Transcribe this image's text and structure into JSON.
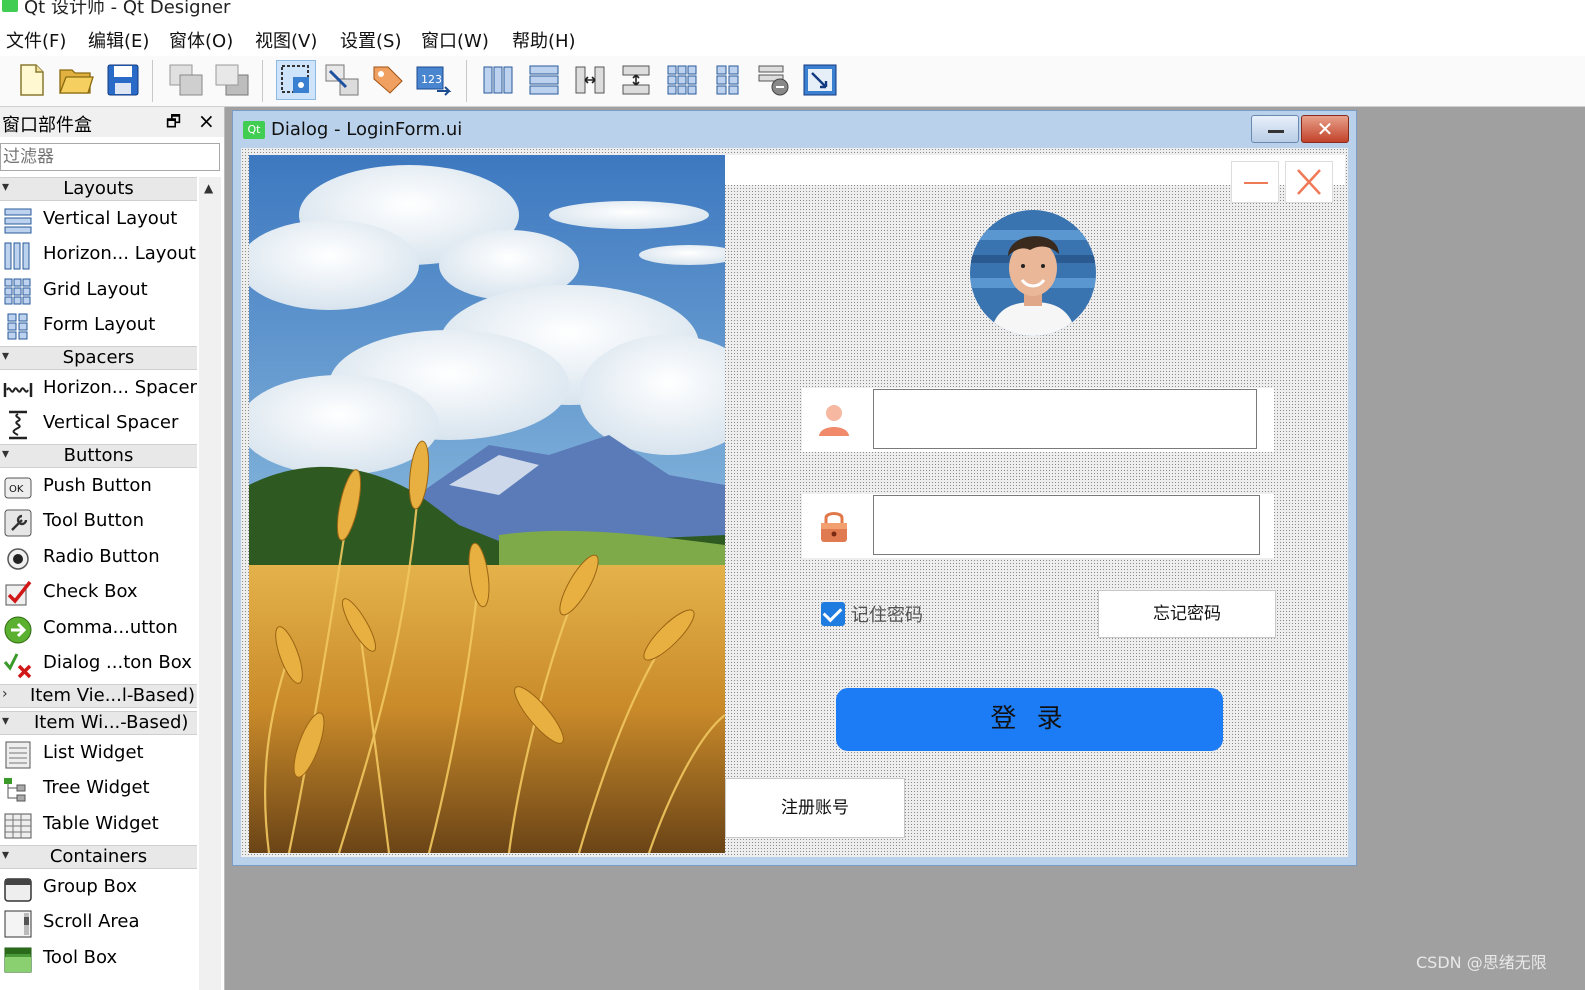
{
  "app": {
    "title": "Qt 设计师 - Qt Designer"
  },
  "menu": [
    "文件(F)",
    "编辑(E)",
    "窗体(O)",
    "视图(V)",
    "设置(S)",
    "窗口(W)",
    "帮助(H)"
  ],
  "toolbar": {
    "icons": [
      "new-file-icon",
      "open-folder-icon",
      "save-icon",
      "send-to-back-icon",
      "bring-to-front-icon",
      "edit-widgets-icon",
      "edit-signals-slots-icon",
      "edit-buddies-icon",
      "edit-tab-order-icon",
      "layout-horizontal-icon",
      "layout-vertical-icon",
      "layout-horizontal-splitter-icon",
      "layout-vertical-splitter-icon",
      "layout-grid-icon",
      "layout-form-icon",
      "break-layout-icon",
      "adjust-size-icon"
    ],
    "active": "edit-widgets-icon"
  },
  "widget_box": {
    "title": "窗口部件盒",
    "filter_placeholder": "过滤器",
    "layouts": "Layouts",
    "spacers": "Spacers",
    "buttons": "Buttons",
    "item_views": "Item Vie...l-Based)",
    "item_widgets": "Item Wi...-Based)",
    "containers": "Containers",
    "vertical_layout": "Vertical Layout",
    "horizontal_layout": "Horizon... Layout",
    "grid_layout": "Grid Layout",
    "form_layout": "Form Layout",
    "horizontal_spacer": "Horizon... Spacer",
    "vertical_spacer": "Vertical Spacer",
    "push_button": "Push Button",
    "tool_button": "Tool Button",
    "radio_button": "Radio Button",
    "check_box": "Check Box",
    "command_link": "Comma...utton",
    "dialog_button_box": "Dialog ...ton Box",
    "list_widget": "List Widget",
    "tree_widget": "Tree Widget",
    "table_widget": "Table Widget",
    "group_box": "Group Box",
    "scroll_area": "Scroll Area",
    "tool_box": "Tool Box"
  },
  "form_window": {
    "title": "Dialog - LoginForm.ui",
    "icon_text": "Qt",
    "username_value": "",
    "password_value": "",
    "remember_label": "记住密码",
    "remember_checked": true,
    "forgot_label": "忘记密码",
    "login_label": "登 录",
    "register_label": "注册账号",
    "login_color": "#1c7cf5",
    "accent_color": "#f07a58"
  },
  "watermark": "CSDN @思绪无限"
}
